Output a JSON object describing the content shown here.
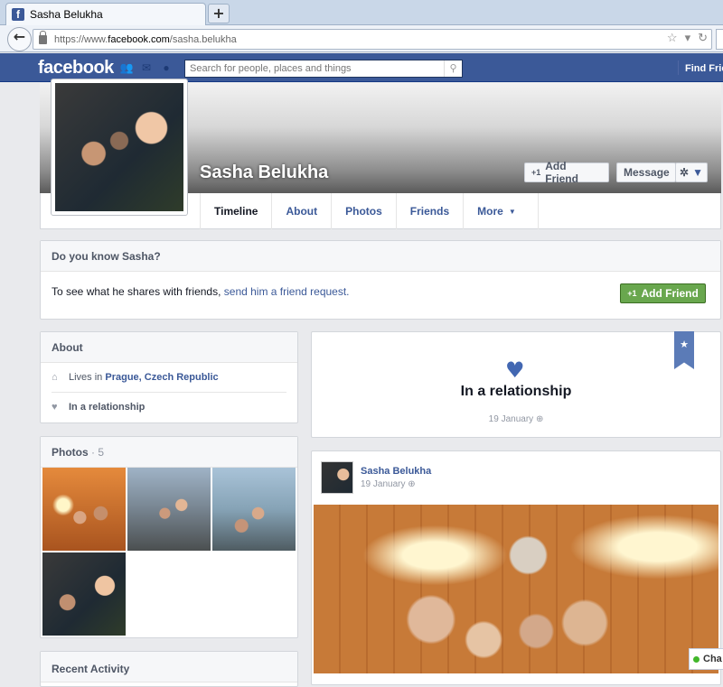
{
  "browser": {
    "tab_title": "Sasha Belukha",
    "favicon": "f",
    "new_tab": "+",
    "url_prefix": "https://www.",
    "url_domain": "facebook.com",
    "url_path": "/sasha.belukha"
  },
  "header": {
    "logo": "facebook",
    "search_placeholder": "Search for people, places and things",
    "find_friends": "Find Frie"
  },
  "profile": {
    "name": "Sasha Belukha",
    "add_friend": "Add Friend",
    "message": "Message",
    "tabs": [
      "Timeline",
      "About",
      "Photos",
      "Friends",
      "More"
    ]
  },
  "know_box": {
    "title": "Do you know Sasha?",
    "text": "To see what he shares with friends, ",
    "link": "send him a friend request.",
    "button": "Add Friend"
  },
  "about": {
    "title": "About",
    "lives_prefix": "Lives in ",
    "lives_place": "Prague, Czech Republic",
    "relationship": "In a relationship"
  },
  "photos": {
    "title": "Photos",
    "count": "· 5"
  },
  "recent": {
    "title": "Recent Activity"
  },
  "life_event": {
    "title": "In a relationship",
    "date": "19 January"
  },
  "post": {
    "author": "Sasha Belukha",
    "date": "19 January"
  },
  "chat": {
    "label": "Cha"
  },
  "colors": {
    "brand": "#3b5998",
    "green": "#69a74e"
  }
}
